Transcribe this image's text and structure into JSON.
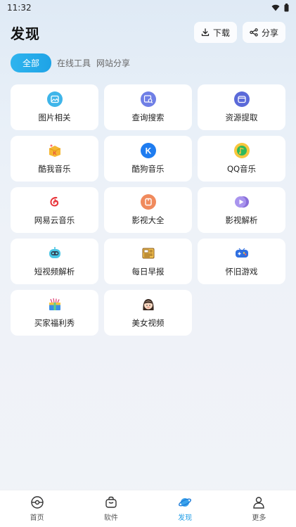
{
  "status_bar": {
    "time": "11:32"
  },
  "header": {
    "title": "发现",
    "download_label": "下载",
    "share_label": "分享"
  },
  "tabs": [
    {
      "label": "全部",
      "active": true
    },
    {
      "label": "在线工具",
      "active": false
    },
    {
      "label": "网站分享",
      "active": false
    }
  ],
  "cards": [
    {
      "label": "图片相关",
      "icon": "image-icon"
    },
    {
      "label": "查询搜索",
      "icon": "search-icon"
    },
    {
      "label": "资源提取",
      "icon": "extract-icon"
    },
    {
      "label": "酷我音乐",
      "icon": "kuwo-icon"
    },
    {
      "label": "酷狗音乐",
      "icon": "kugou-icon"
    },
    {
      "label": "QQ音乐",
      "icon": "qq-music-icon"
    },
    {
      "label": "网易云音乐",
      "icon": "netease-music-icon"
    },
    {
      "label": "影视大全",
      "icon": "tv-icon"
    },
    {
      "label": "影视解析",
      "icon": "video-parse-icon"
    },
    {
      "label": "短视频解析",
      "icon": "robot-icon"
    },
    {
      "label": "每日早报",
      "icon": "newspaper-icon"
    },
    {
      "label": "怀旧游戏",
      "icon": "gamepad-icon"
    },
    {
      "label": "买家福利秀",
      "icon": "gift-icon"
    },
    {
      "label": "美女视频",
      "icon": "girl-icon"
    }
  ],
  "bottom_nav": [
    {
      "label": "首页",
      "icon": "home-icon",
      "active": false
    },
    {
      "label": "软件",
      "icon": "bag-icon",
      "active": false
    },
    {
      "label": "发现",
      "icon": "planet-icon",
      "active": true
    },
    {
      "label": "更多",
      "icon": "user-icon",
      "active": false
    }
  ],
  "colors": {
    "accent": "#1e9ce6",
    "tab_active": "#2fb4ee"
  }
}
